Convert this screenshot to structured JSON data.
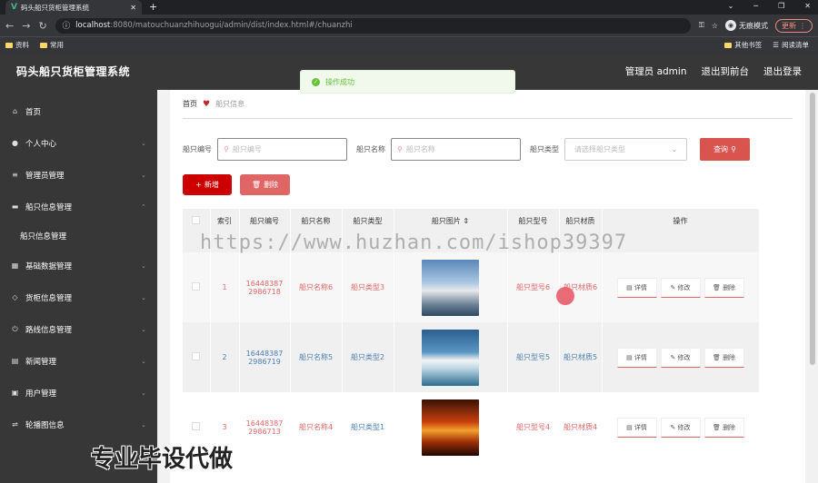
{
  "browser": {
    "tab_title": "码头船只货柜管理系统",
    "url_host": "localhost",
    "url_path": ":8080/matouchuanzhihuogui/admin/dist/index.html#/chuanzhi",
    "incognito_label": "无痕模式",
    "update_label": "更新",
    "bookmarks": [
      "资料",
      "常用"
    ],
    "bookmarks_right": [
      "其他书签",
      "阅读清单"
    ]
  },
  "header": {
    "title": "码头船只货柜管理系统",
    "admin_label": "管理员 admin",
    "back_front_label": "退出到前台",
    "logout_label": "退出登录"
  },
  "toast": {
    "message": "操作成功"
  },
  "sidebar": {
    "items": [
      {
        "label": "首页",
        "icon": "home-icon"
      },
      {
        "label": "个人中心",
        "icon": "user-icon"
      },
      {
        "label": "管理员管理",
        "icon": "list-icon"
      },
      {
        "label": "船只信息管理",
        "icon": "ship-icon"
      },
      {
        "label": "基础数据管理",
        "icon": "grid-icon"
      },
      {
        "label": "货柜信息管理",
        "icon": "tag-icon"
      },
      {
        "label": "路线信息管理",
        "icon": "power-icon"
      },
      {
        "label": "新闻管理",
        "icon": "news-icon"
      },
      {
        "label": "用户管理",
        "icon": "users-icon"
      },
      {
        "label": "轮播图信息",
        "icon": "slider-icon"
      }
    ],
    "subitem": "船只信息管理"
  },
  "breadcrumb": {
    "home": "首页",
    "current": "船只信息"
  },
  "search": {
    "label1": "船只编号",
    "placeholder1": "船只编号",
    "label2": "船只名称",
    "placeholder2": "船只名称",
    "label3": "船只类型",
    "placeholder3": "请选择船只类型",
    "query_label": "查询"
  },
  "actions": {
    "add_label": "新增",
    "delete_label": "删除"
  },
  "table": {
    "headers": [
      "索引",
      "船只编号",
      "船只名称",
      "船只类型",
      "船只图片",
      "船只型号",
      "船只材质",
      "操作"
    ],
    "rows": [
      {
        "index": "1",
        "code1": "16448387",
        "code2": "2986718",
        "name": "船只名称6",
        "type": "船只类型3",
        "model": "船只型号6",
        "material": "船只材质6"
      },
      {
        "index": "2",
        "code1": "16448387",
        "code2": "2986719",
        "name": "船只名称5",
        "type": "船只类型2",
        "model": "船只型号5",
        "material": "船只材质5"
      },
      {
        "index": "3",
        "code1": "16448387",
        "code2": "2986713",
        "name": "船只名称4",
        "type": "船只类型1",
        "model": "船只型号4",
        "material": "船只材质4"
      }
    ],
    "op_detail": "详情",
    "op_edit": "修改",
    "op_delete": "删除"
  },
  "watermark": "https://www.huzhan.com/ishop39397",
  "watermark2": "专业毕设代做"
}
